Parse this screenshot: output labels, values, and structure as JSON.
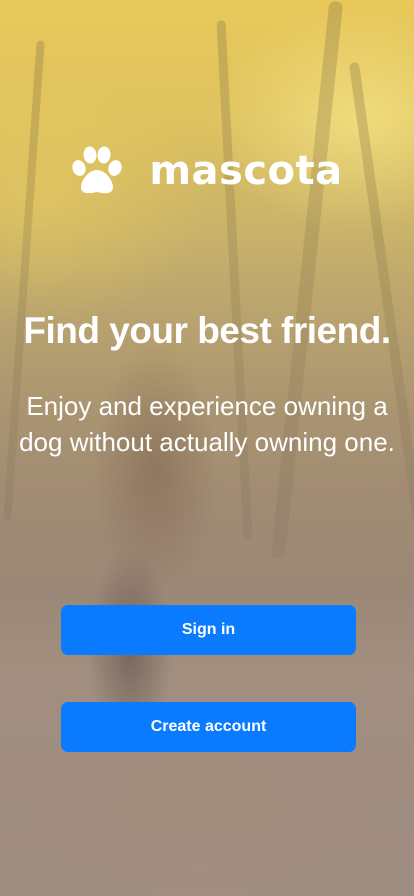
{
  "app": {
    "brand_name": "mascota",
    "logo_icon": "paw-icon"
  },
  "hero": {
    "headline": "Find your best friend.",
    "subtitle": "Enjoy and experience owning a dog without actually owning one."
  },
  "actions": {
    "sign_in_label": "Sign in",
    "create_account_label": "Create account"
  },
  "colors": {
    "primary_button": "#0a7bff",
    "text": "#ffffff"
  }
}
